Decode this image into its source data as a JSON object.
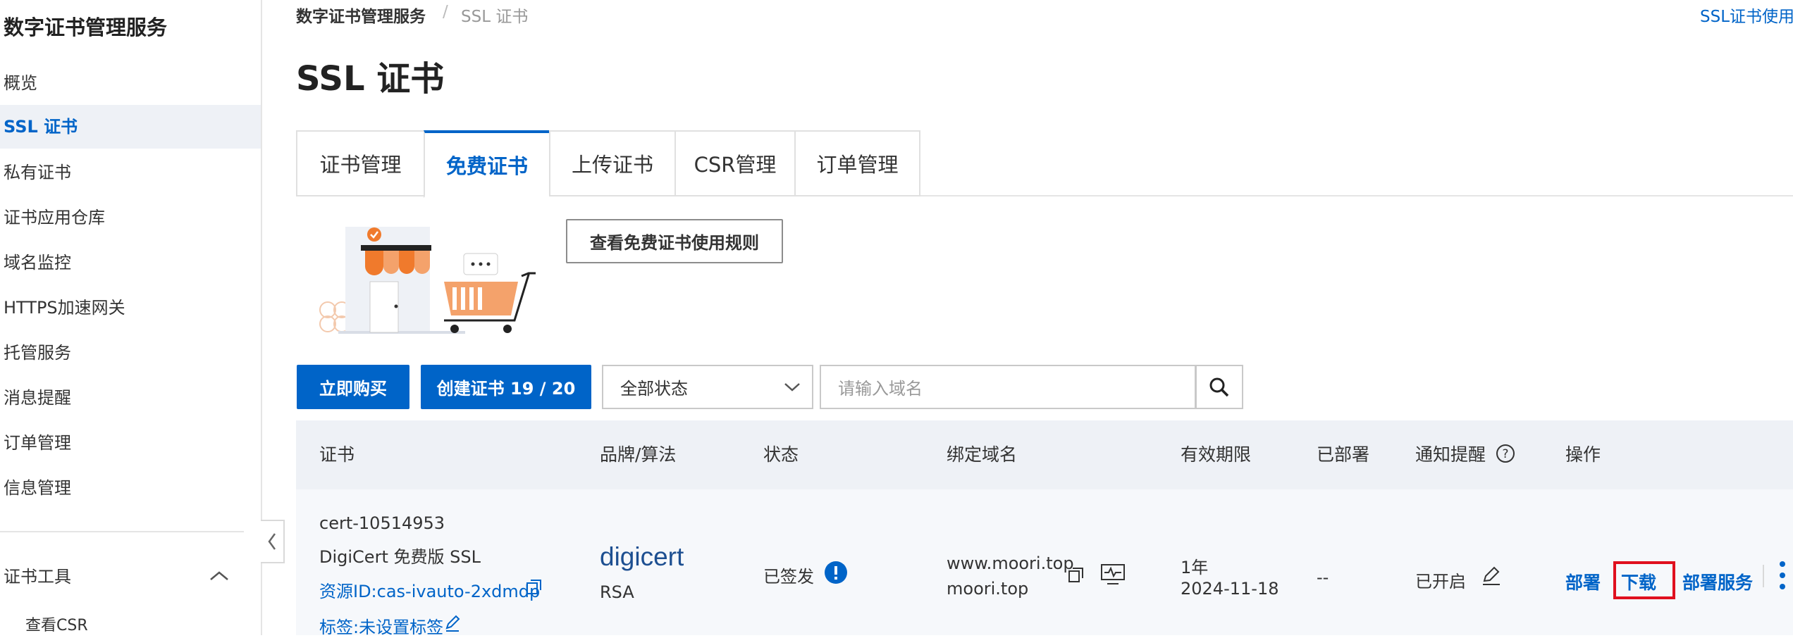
{
  "sidebar": {
    "title": "数字证书管理服务",
    "items": [
      {
        "label": "概览"
      },
      {
        "label": "SSL 证书"
      },
      {
        "label": "私有证书"
      },
      {
        "label": "证书应用仓库"
      },
      {
        "label": "域名监控"
      },
      {
        "label": "HTTPS加速网关"
      },
      {
        "label": "托管服务"
      },
      {
        "label": "消息提醒"
      },
      {
        "label": "订单管理"
      },
      {
        "label": "信息管理"
      }
    ],
    "tools_label": "证书工具",
    "tools_items": [
      {
        "label": "查看CSR"
      }
    ]
  },
  "breadcrumb": {
    "root": "数字证书管理服务",
    "separator": "/",
    "current": "SSL 证书"
  },
  "header": {
    "title": "SSL 证书",
    "help_link": "SSL证书使用"
  },
  "tabs": [
    {
      "label": "证书管理"
    },
    {
      "label": "免费证书"
    },
    {
      "label": "上传证书"
    },
    {
      "label": "CSR管理"
    },
    {
      "label": "订单管理"
    }
  ],
  "rules_button": "查看免费证书使用规则",
  "toolbar": {
    "buy_label": "立即购买",
    "create_label": "创建证书 19 / 20",
    "status_select": "全部状态",
    "search_placeholder": "请输入域名"
  },
  "table": {
    "columns": [
      "证书",
      "品牌/算法",
      "状态",
      "绑定域名",
      "有效期限",
      "已部署",
      "通知提醒",
      "操作"
    ],
    "rows": [
      {
        "cert_name": "cert-10514953",
        "cert_type": "DigiCert 免费版 SSL",
        "resource_id": "资源ID:cas-ivauto-2xdmdp",
        "tag": "标签:未设置标签",
        "brand": "digicert",
        "algorithm": "RSA",
        "status": "已签发",
        "domain1": "www.moori.top",
        "domain2": "moori.top",
        "validity": "1年",
        "expire_date": "2024-11-18",
        "deployed": "--",
        "notify": "已开启",
        "actions": {
          "deploy": "部署",
          "download": "下载",
          "deploy_service": "部署服务"
        }
      }
    ]
  },
  "colors": {
    "primary": "#0064c8",
    "highlight": "#e0101e",
    "header_bg": "#eef1f6"
  }
}
